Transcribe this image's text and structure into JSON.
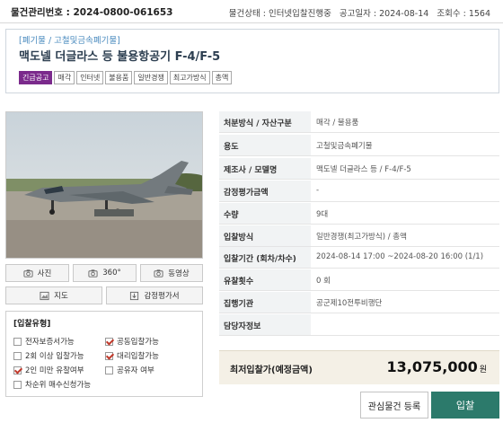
{
  "top": {
    "management_no": "물건관리번호 : 2024-0800-061653",
    "status": "물건상태 : 인터넷입찰진행중",
    "notice_date": "공고일자 : 2024-08-14",
    "views": "조회수 : 1564"
  },
  "header": {
    "breadcrumb": "[폐기물 / 고철및금속폐기물]",
    "title": "맥도넬 더글라스 등 불용항공기 F-4/F-5",
    "tags": [
      "긴급공고",
      "매각",
      "인터넷",
      "불용품",
      "일반경쟁",
      "최고가방식",
      "총액"
    ]
  },
  "media": {
    "photo": "사진",
    "view360": "360°",
    "video": "동영상",
    "map": "지도",
    "appraisal": "감정평가서"
  },
  "bid_type": {
    "heading": "[입찰유형]",
    "options": [
      {
        "label": "전자보증서가능",
        "checked": false
      },
      {
        "label": "공동입찰가능",
        "checked": true
      },
      {
        "label": "2회 이상 입찰가능",
        "checked": false
      },
      {
        "label": "대리입찰가능",
        "checked": true
      },
      {
        "label": "2인 미만 유찰여부",
        "checked": true
      },
      {
        "label": "공유자 여부",
        "checked": false
      },
      {
        "label": "차순위 매수신청가능",
        "checked": false
      }
    ]
  },
  "info": {
    "rows": [
      {
        "label": "처분방식 / 자산구분",
        "value": "매각 / 불용품"
      },
      {
        "label": "용도",
        "value": "고철및금속폐기물"
      },
      {
        "label": "제조사 / 모델명",
        "value": "맥도넬 더글라스 등 / F-4/F-5"
      },
      {
        "label": "감정평가금액",
        "value": "-"
      },
      {
        "label": "수량",
        "value": "9대"
      },
      {
        "label": "입찰방식",
        "value": "일반경쟁(최고가방식) / 총액"
      },
      {
        "label": "입찰기간 (회차/차수)",
        "value": "2024-08-14 17:00 ~2024-08-20 16:00 (1/1)"
      },
      {
        "label": "유찰횟수",
        "value": "0 회"
      },
      {
        "label": "집행기관",
        "value": "공군제10전투비행단"
      },
      {
        "label": "담당자정보",
        "value": ""
      }
    ]
  },
  "price": {
    "label": "최저입찰가(예정금액)",
    "value": "13,075,000",
    "unit": "원"
  },
  "actions": {
    "favorite": "관심물건 등록",
    "bid": "입찰"
  },
  "colors": {
    "urgent_tag": "#7b2a8c",
    "bid_button": "#2c7a6b",
    "breadcrumb": "#4b8bbf",
    "check_mark": "#c0392b"
  }
}
